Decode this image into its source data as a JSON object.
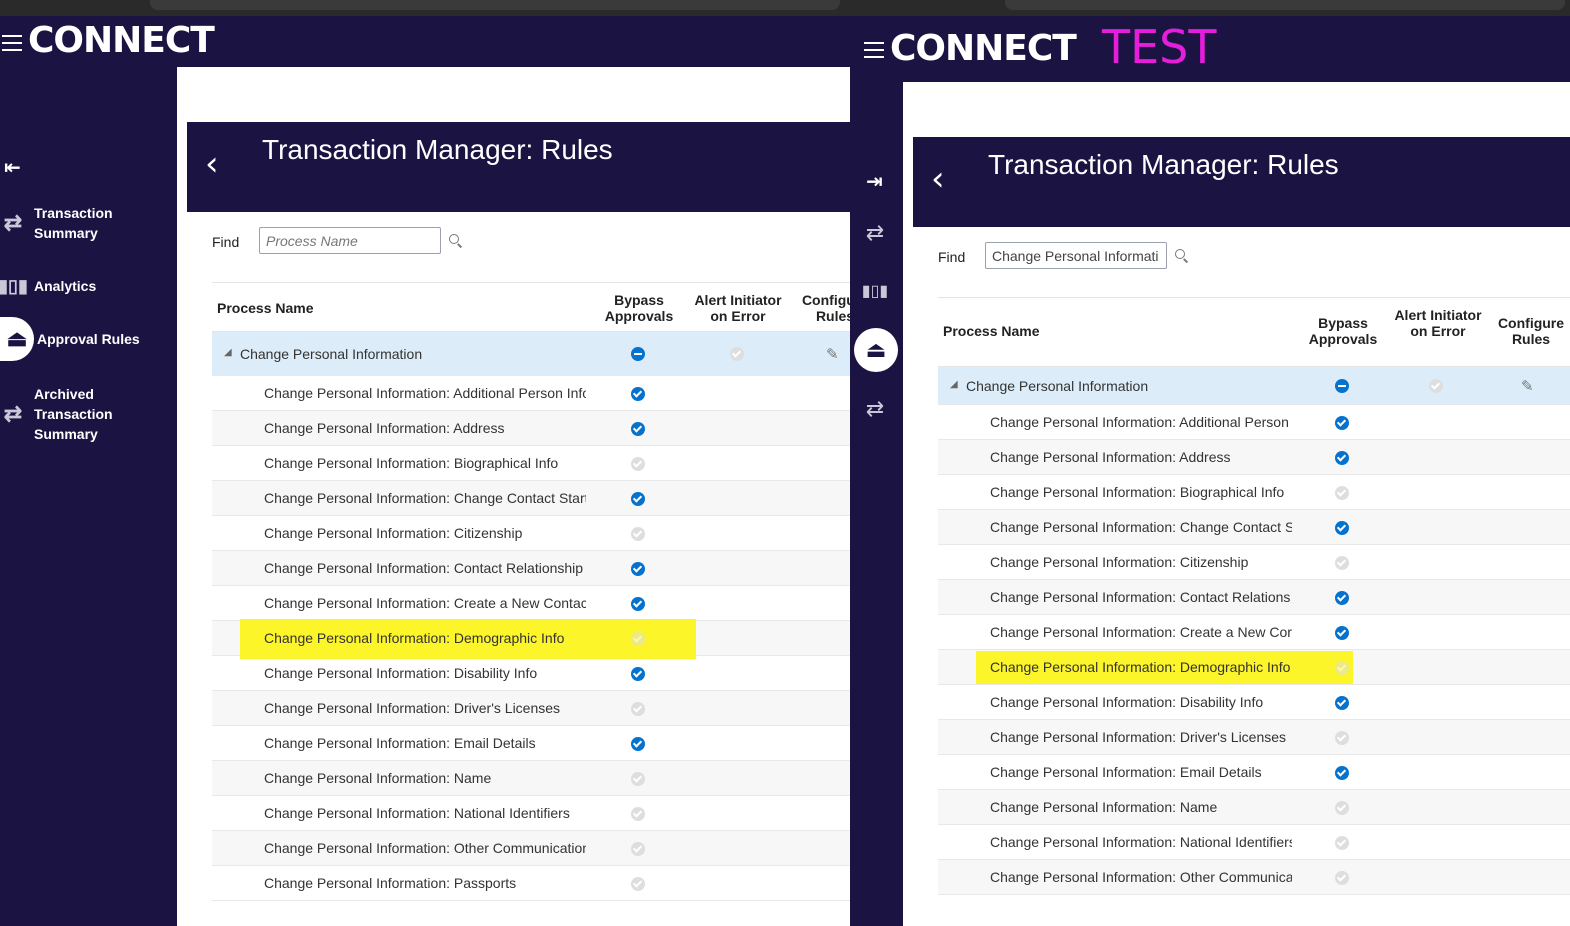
{
  "left_window": {
    "brand": "CONNECT",
    "nav": [
      {
        "label": "Transaction Summary",
        "icon": "transfer-arrows-icon"
      },
      {
        "label": "Analytics",
        "icon": "analytics-chart-icon"
      },
      {
        "label": "Approval Rules",
        "icon": "approval-rules-icon"
      },
      {
        "label": "Archived Transaction Summary",
        "icon": "transfer-arrows-icon"
      }
    ],
    "page_title": "Transaction Manager: Rules",
    "find_label": "Find",
    "find_value": "",
    "find_placeholder": "Process Name",
    "columns": {
      "process_name": "Process Name",
      "bypass": "Bypass Approvals",
      "alert": "Alert Initiator on Error",
      "configure": "Configure Rules"
    },
    "parent": {
      "name": "Change Personal Information",
      "bypass": "minus",
      "alert": "grey"
    },
    "rows": [
      {
        "name": "Change Personal Information: Additional Person Information",
        "bypass": "check"
      },
      {
        "name": "Change Personal Information: Address",
        "bypass": "check"
      },
      {
        "name": "Change Personal Information: Biographical Info",
        "bypass": "grey"
      },
      {
        "name": "Change Personal Information: Change Contact Start Date",
        "bypass": "check"
      },
      {
        "name": "Change Personal Information: Citizenship",
        "bypass": "grey"
      },
      {
        "name": "Change Personal Information: Contact Relationship",
        "bypass": "check"
      },
      {
        "name": "Change Personal Information: Create a New Contact",
        "bypass": "check"
      },
      {
        "name": "Change Personal Information: Demographic Info",
        "bypass": "grey",
        "highlight": true
      },
      {
        "name": "Change Personal Information: Disability Info",
        "bypass": "check"
      },
      {
        "name": "Change Personal Information: Driver's Licenses",
        "bypass": "grey"
      },
      {
        "name": "Change Personal Information: Email Details",
        "bypass": "check"
      },
      {
        "name": "Change Personal Information: Name",
        "bypass": "grey"
      },
      {
        "name": "Change Personal Information: National Identifiers",
        "bypass": "grey"
      },
      {
        "name": "Change Personal Information: Other Communication",
        "bypass": "grey"
      },
      {
        "name": "Change Personal Information: Passports",
        "bypass": "grey"
      }
    ]
  },
  "right_window": {
    "brand": "CONNECT",
    "env_label": "TEST",
    "page_title": "Transaction Manager: Rules",
    "find_label": "Find",
    "find_value": "Change Personal Informati",
    "columns": {
      "process_name": "Process Name",
      "bypass": "Bypass Approvals",
      "alert": "Alert Initiator on Error",
      "configure": "Configure Rules"
    },
    "parent": {
      "name": "Change Personal Information",
      "bypass": "minus",
      "alert": "grey"
    },
    "rows": [
      {
        "name": "Change Personal Information: Additional Person",
        "bypass": "check"
      },
      {
        "name": "Change Personal Information: Address",
        "bypass": "check"
      },
      {
        "name": "Change Personal Information: Biographical Info",
        "bypass": "grey"
      },
      {
        "name": "Change Personal Information: Change Contact S",
        "bypass": "check"
      },
      {
        "name": "Change Personal Information: Citizenship",
        "bypass": "grey"
      },
      {
        "name": "Change Personal Information: Contact Relations",
        "bypass": "check"
      },
      {
        "name": "Change Personal Information: Create a New Cor",
        "bypass": "check"
      },
      {
        "name": "Change Personal Information: Demographic Info",
        "bypass": "grey",
        "highlight": true
      },
      {
        "name": "Change Personal Information: Disability Info",
        "bypass": "check"
      },
      {
        "name": "Change Personal Information: Driver's Licenses",
        "bypass": "grey"
      },
      {
        "name": "Change Personal Information: Email Details",
        "bypass": "check"
      },
      {
        "name": "Change Personal Information: Name",
        "bypass": "grey"
      },
      {
        "name": "Change Personal Information: National Identifiers",
        "bypass": "grey"
      },
      {
        "name": "Change Personal Information: Other Communica",
        "bypass": "grey"
      }
    ]
  },
  "colors": {
    "navy": "#1b1443",
    "accent_test": "#e61edc",
    "highlight": "#fbf52a",
    "check_blue": "#0572ce"
  }
}
